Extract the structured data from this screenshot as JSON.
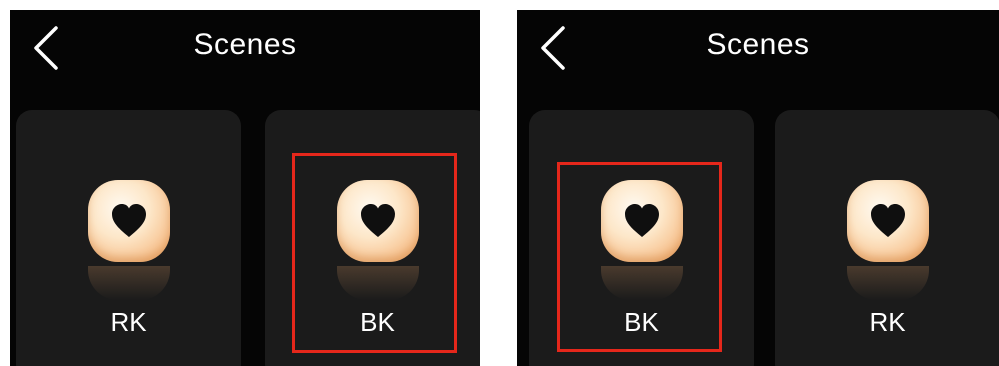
{
  "screens": [
    {
      "title": "Scenes",
      "cards": [
        {
          "label": "RK",
          "icon": "heart-icon",
          "selected": false
        },
        {
          "label": "BK",
          "icon": "heart-icon",
          "selected": true
        }
      ]
    },
    {
      "title": "Scenes",
      "cards": [
        {
          "label": "BK",
          "icon": "heart-icon",
          "selected": true
        },
        {
          "label": "RK",
          "icon": "heart-icon",
          "selected": false
        }
      ]
    }
  ],
  "colors": {
    "background": "#050505",
    "card": "#1b1b1b",
    "text": "#ffffff",
    "icon_gradient": [
      "#fffaf2",
      "#fde7c9",
      "#f7c391",
      "#efa968"
    ],
    "highlight": "#e5271b"
  }
}
